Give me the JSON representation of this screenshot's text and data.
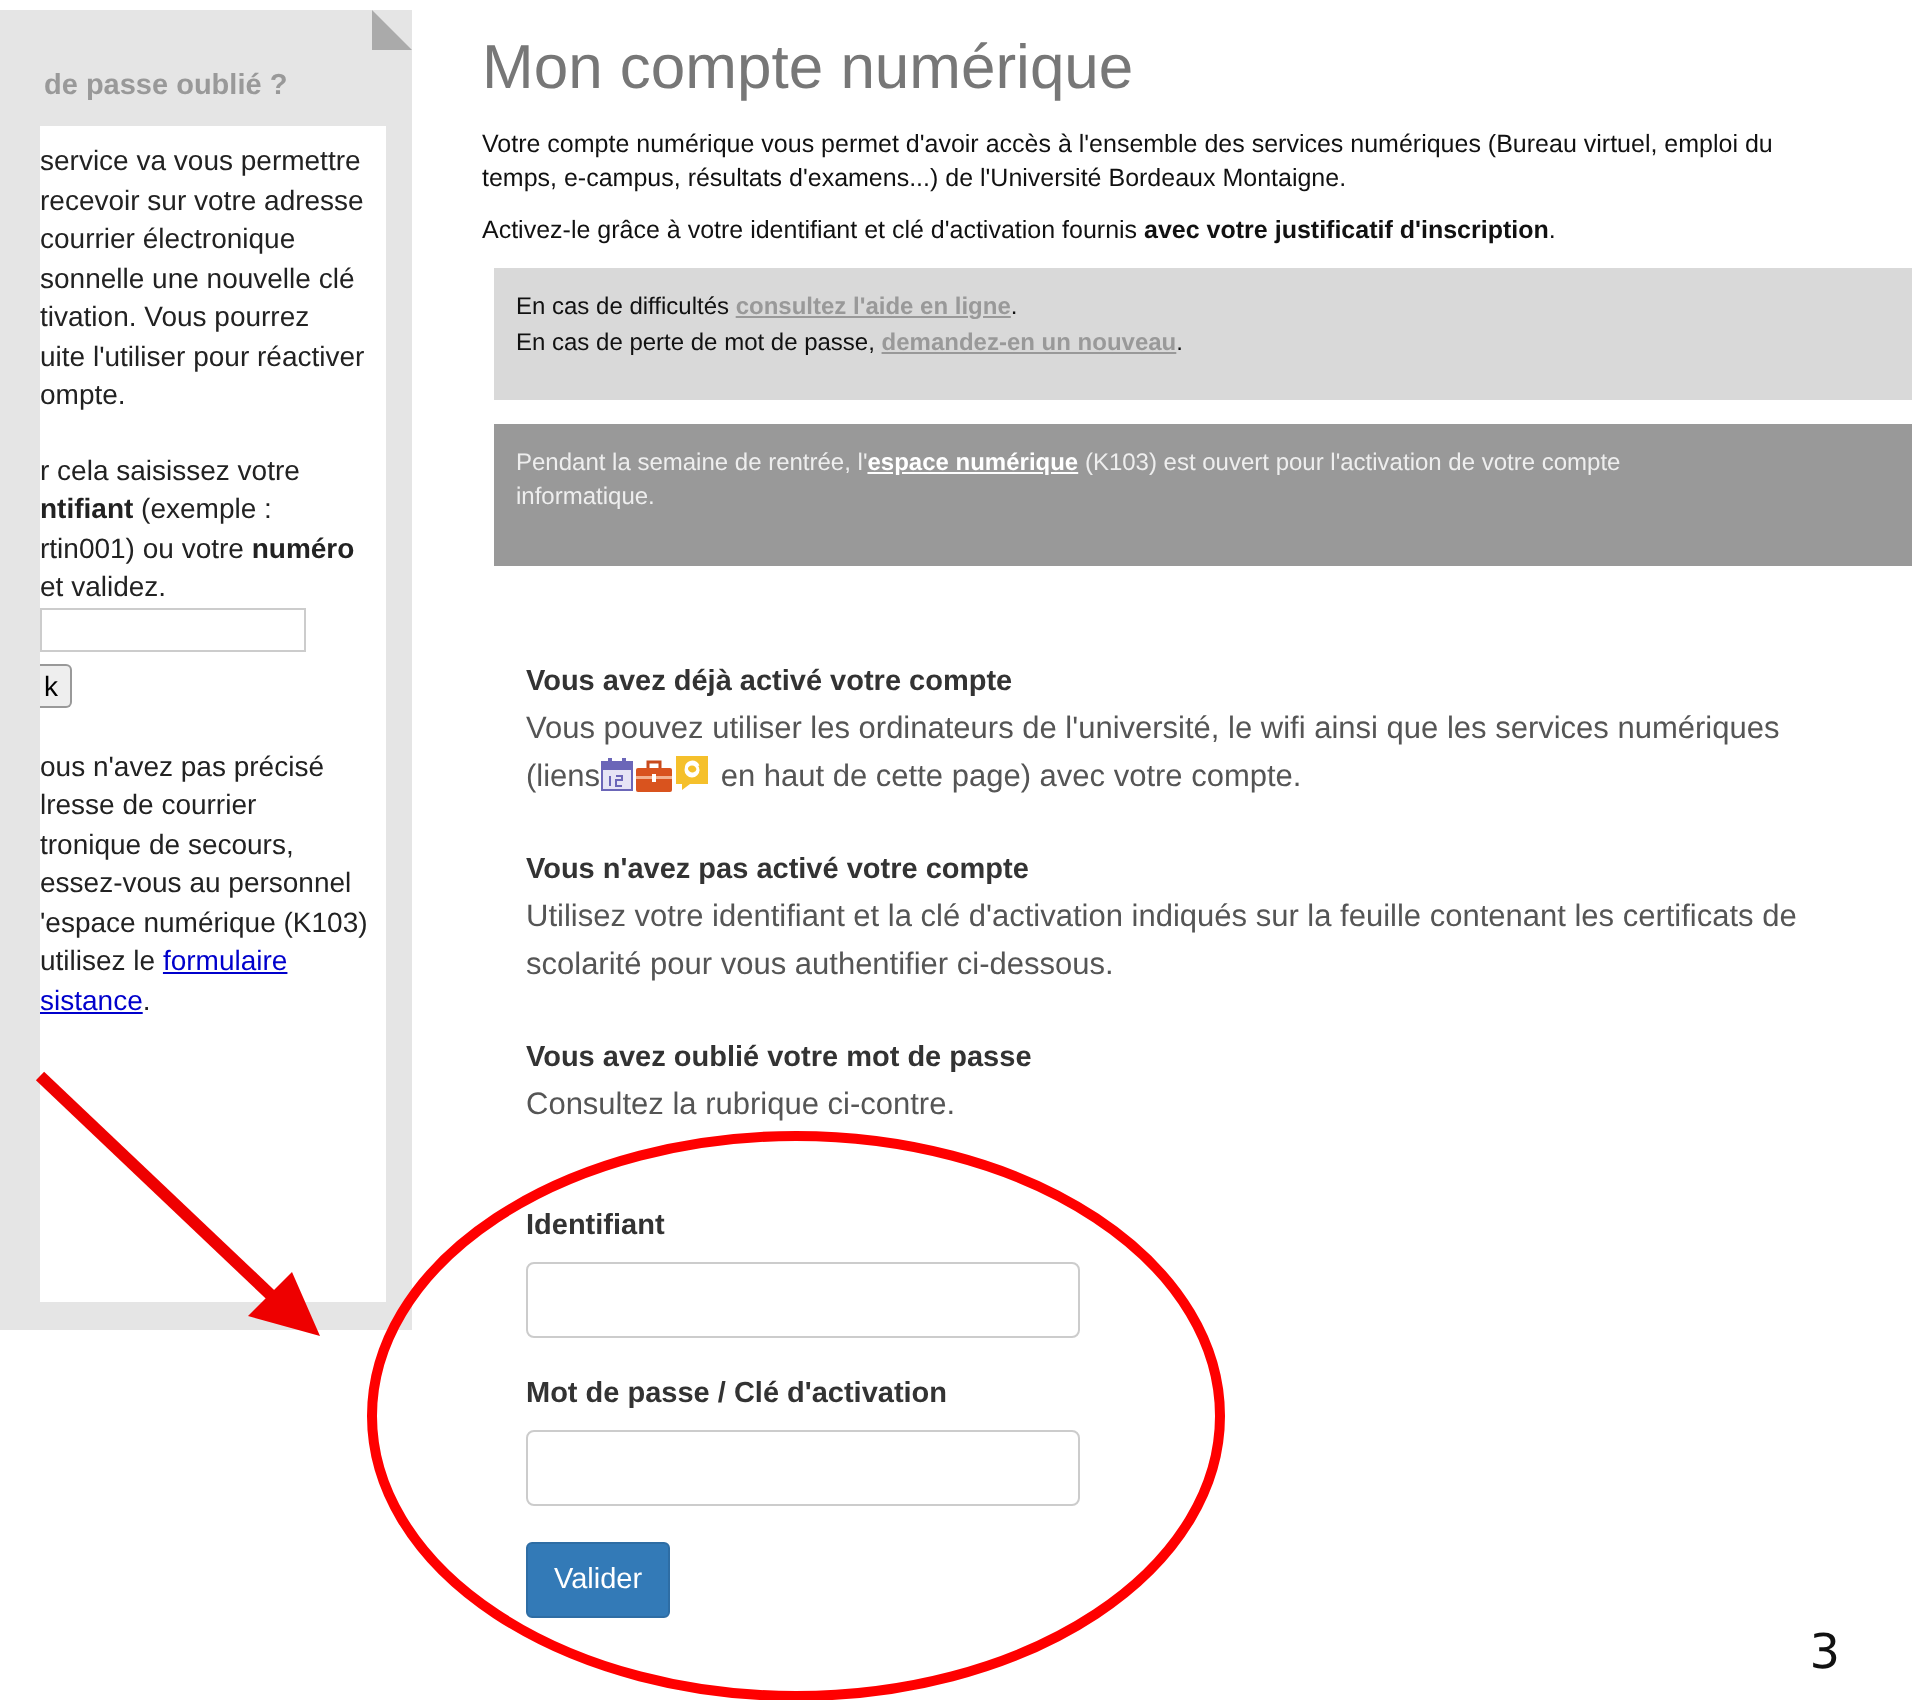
{
  "sidebar": {
    "title": "de passe oublié ?",
    "paragraphs": [
      [
        "service va vous permettre",
        "recevoir sur votre adresse",
        "courrier électronique",
        "sonnelle une nouvelle clé",
        "tivation. Vous pourrez",
        "uite l'utiliser pour réactiver",
        "ompte."
      ],
      [
        "r cela saisissez votre",
        "**ntifiant** (exemple :",
        "rtin001) ou votre **numéro**",
        "et validez."
      ]
    ],
    "button": "k",
    "help_lines": [
      {
        "text": "ous n'avez pas précisé"
      },
      {
        "text": "lresse de courrier"
      },
      {
        "text": "tronique de secours,"
      },
      {
        "text": "essez-vous au personnel"
      },
      {
        "text": "'espace numérique (K103)"
      },
      {
        "text": "utilisez le ",
        "link": "formulaire"
      },
      {
        "link": "sistance",
        "after": "."
      }
    ]
  },
  "main": {
    "title": "Mon compte numérique",
    "intro": [
      "Votre compte numérique vous permet d'avoir accès à l'ensemble des services numériques (Bureau virtuel, emploi du temps, e-campus, résultats d'examens...) de l'Université Bordeaux Montaigne.",
      "Activez-le grâce à votre identifiant et clé d'activation fournis **avec votre justificatif d'inscription**."
    ],
    "help_box": [
      {
        "text": "En cas de difficultés ",
        "link": "consultez l'aide en ligne",
        "after": "."
      },
      {
        "text": "En cas de perte de mot de passe, ",
        "link": "demandez-en un nouveau",
        "after": "."
      }
    ],
    "notice": {
      "text": "Pendant la semaine de rentrée, l'",
      "link": "espace numérique",
      "after": " (K103) est ouvert pour l'activation de votre compte informatique."
    },
    "sections": [
      {
        "heading": "Vous avez déjà activé votre compte",
        "kind": "icons",
        "text": "Vous pouvez utiliser les ordinateurs de l'université, le wifi ainsi que les services numériques (liens",
        "after": "en haut de cette page) avec votre compte."
      },
      {
        "heading": "Vous n'avez pas activé votre compte",
        "kind": "plain",
        "text": "Utilisez votre identifiant et la clé d'activation indiqués sur la feuille contenant les certificats de scolarité pour vous authentifier ci-dessous."
      },
      {
        "heading": "Vous avez oublié votre mot de passe",
        "kind": "plain",
        "text": "Consultez la rubrique ci-contre."
      }
    ],
    "form": {
      "fields": [
        {
          "label": "Identifiant"
        },
        {
          "label": "Mot de passe / Clé d'activation"
        }
      ],
      "submit": "Valider"
    }
  },
  "slide_number": "3"
}
